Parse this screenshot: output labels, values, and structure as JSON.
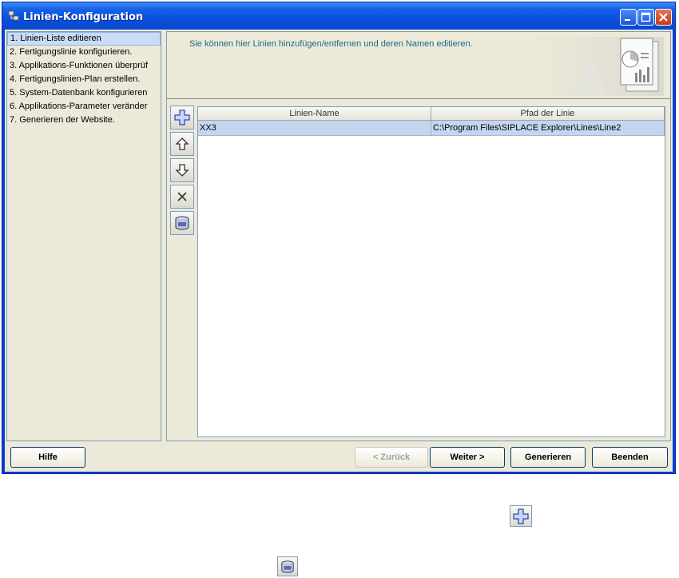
{
  "window": {
    "title": "Linien-Konfiguration"
  },
  "sidebar": {
    "items": [
      {
        "label": "1. Linien-Liste editieren",
        "selected": true
      },
      {
        "label": "2. Fertigungslinie konfigurieren.",
        "selected": false
      },
      {
        "label": "3. Applikations-Funktionen überprüf",
        "selected": false
      },
      {
        "label": "4. Fertigungslinien-Plan erstellen.",
        "selected": false
      },
      {
        "label": "5. System-Datenbank konfigurieren",
        "selected": false
      },
      {
        "label": "6. Applikations-Parameter veränder",
        "selected": false
      },
      {
        "label": "7. Generieren der Website.",
        "selected": false
      }
    ]
  },
  "header": {
    "text": "Sie können hier Linien hinzufügen/entfernen und deren Namen editieren."
  },
  "table": {
    "columns": [
      "Linien-Name",
      "Pfad der Linie"
    ],
    "rows": [
      [
        "XX3",
        "C:\\Program Files\\SIPLACE Explorer\\Lines\\Line2"
      ]
    ]
  },
  "toolbar": {
    "icons": [
      "add-icon",
      "arrow-up-icon",
      "arrow-down-icon",
      "delete-icon",
      "database-icon"
    ]
  },
  "footer": {
    "help": "Hilfe",
    "back": "< Zurück",
    "next": "Weiter >",
    "generate": "Generieren",
    "finish": "Beenden"
  },
  "colors": {
    "titlebar": "#0a4fdb",
    "selection": "#c4d6ef",
    "header_text": "#1d6a8a"
  }
}
